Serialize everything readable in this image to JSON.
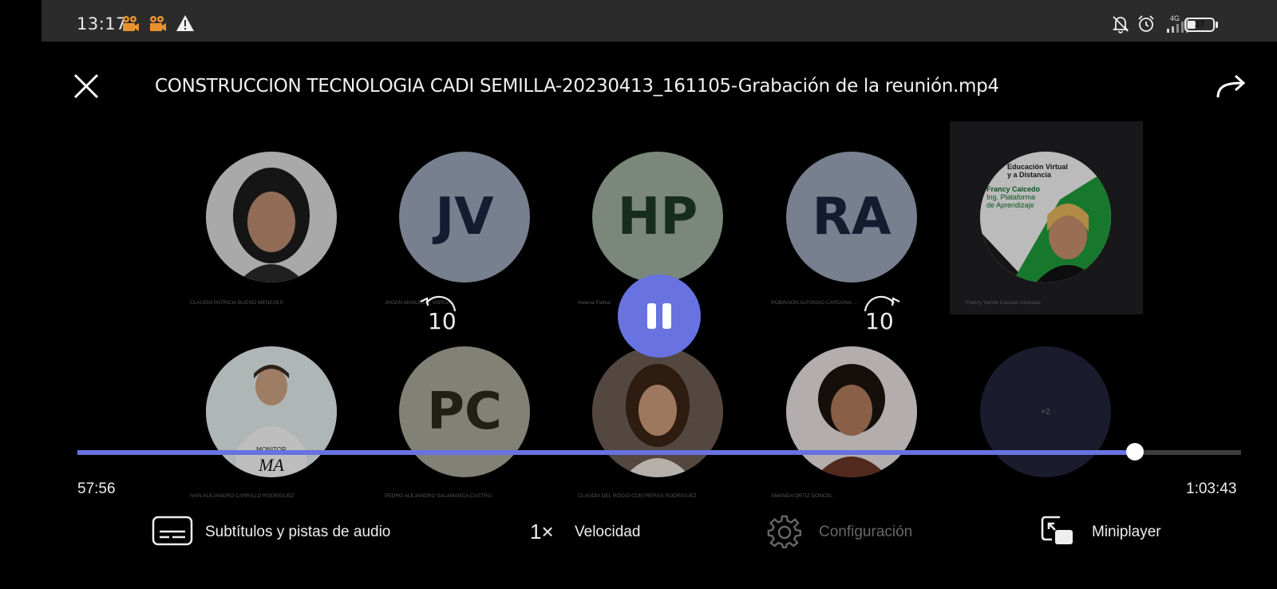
{
  "status_bar": {
    "time": "13:17",
    "left_icons": [
      "video-app-icon",
      "video-app-icon",
      "warning-icon"
    ],
    "right_icons": [
      "bell-muted-icon",
      "alarm-icon",
      "signal-icon",
      "battery-icon"
    ],
    "network": "4G",
    "battery": "37",
    "accent_icon_color": "#e8922e"
  },
  "header": {
    "title": "CONSTRUCCION TECNOLOGIA CADI SEMILLA-20230413_161105-Grabación de la reunión.mp4"
  },
  "participants": [
    {
      "name": "CLAUDIA PATRICIA BUENO MENESES",
      "initials": "",
      "photo": true,
      "color": "#6d6d6d"
    },
    {
      "name": "JHOAN MANUEL ... VARGAS",
      "initials": "JV",
      "photo": false,
      "color": "#9aa3b6"
    },
    {
      "name": "Helena Palma",
      "initials": "HP",
      "photo": false,
      "color": "#9dad9d"
    },
    {
      "name": "ROBINSON ALFONSO CARDONA ...",
      "initials": "RA",
      "photo": false,
      "color": "#9aa3b6"
    },
    {
      "name": "Francy Yamile Caicedo Alvarado",
      "initials": "",
      "photo": true,
      "featured": true,
      "color": "#2b2b2e"
    },
    {
      "name": "IVAN ALEJANDRO CARRILLO RODRIGUEZ",
      "initials": "",
      "photo": true,
      "color": "#8a8a8a"
    },
    {
      "name": "PEDRO ALEJANDRO SALAMANCA CASTRO",
      "initials": "PC",
      "photo": false,
      "color": "#a6a697"
    },
    {
      "name": "CLAUDIA DEL ROCIO CONTRERAS RODRIGUEZ",
      "initials": "",
      "photo": true,
      "color": "#5e5048"
    },
    {
      "name": "AMANDA ORTIZ DONCEL",
      "initials": "",
      "photo": true,
      "color": "#6a4a3c"
    },
    {
      "name": "",
      "initials": "+2",
      "photo": false,
      "color": "#22243a"
    }
  ],
  "featured_card": {
    "line1": "Educación Virtual",
    "line2": "y a Distancia",
    "line3": "Francy Caicedo",
    "line4": "Ing. Plataforma",
    "line5": "de Aprendizaje"
  },
  "playback": {
    "rewind_seconds": "10",
    "forward_seconds": "10",
    "current_time": "57:56",
    "total_time": "1:03:43",
    "progress": 0.909,
    "accent_color": "#6872e0"
  },
  "toolbar": {
    "subtitles_label": "Subtítulos y pistas de audio",
    "speed_value": "1×",
    "speed_label": "Velocidad",
    "settings_label": "Configuración",
    "miniplayer_label": "Miniplayer"
  }
}
